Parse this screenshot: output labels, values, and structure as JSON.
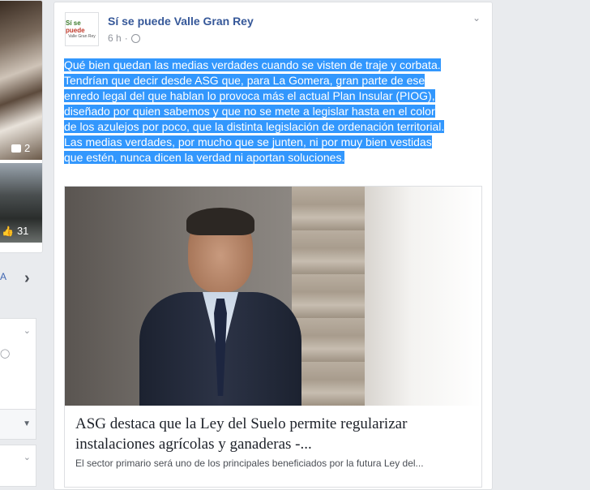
{
  "left_column": {
    "photo1_count": "2",
    "photo2_count": "31",
    "partial_link": "A"
  },
  "post": {
    "page_name": "Sí se puede Valle Gran Rey",
    "time": "6 h",
    "avatar": {
      "line1_green": "Sí se ",
      "line1_red": "puede",
      "line2": "Valle Gran Rey"
    },
    "text_lines": [
      "Qué bien quedan las medias verdades cuando se visten de traje y corbata.",
      "Tendrían que decir desde ASG que, para La Gomera, gran parte de ese",
      "enredo legal del que hablan lo provoca más el actual Plan Insular (PIOG),",
      "diseñado por quien sabemos y que no se mete a legislar hasta en el color",
      "de los azulejos por poco, que la distinta legislación de ordenación territorial.",
      "Las medias verdades, por mucho que se junten, ni por muy bien vestidas",
      "que estén, nunca dicen la verdad ni aportan soluciones."
    ],
    "link": {
      "title": "ASG destaca que la Ley del Suelo permite regularizar instalaciones agrícolas y ganaderas -...",
      "description": "El sector primario será uno de los principales beneficiados por la futura Ley del..."
    }
  },
  "colors": {
    "page_name": "#365899",
    "selection": "#3297fd",
    "background": "#e9ebee"
  }
}
